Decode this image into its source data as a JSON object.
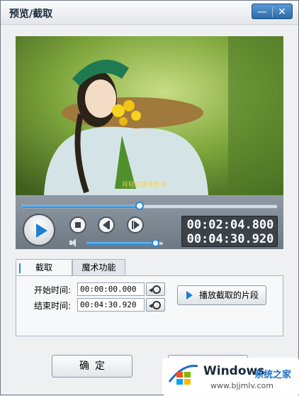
{
  "window": {
    "title": "预览/截取",
    "minimize_label": "—",
    "close_label": "✕"
  },
  "video": {
    "overlay_text": "月轻红雾亭影视"
  },
  "player": {
    "progress_fraction": 0.46,
    "volume_fraction": 0.9,
    "current_time": "00:02:04.800",
    "total_time": "00:04:30.920"
  },
  "tabs": [
    {
      "label": "截取",
      "active": true
    },
    {
      "label": "魔术功能",
      "active": false
    }
  ],
  "clip": {
    "start_label": "开始时间:",
    "start_value": "00:00:00.000",
    "end_label": "结束时间:",
    "end_value": "00:04:30.920",
    "play_clip_label": "播放截取的片段"
  },
  "footer": {
    "ok_label": "确定"
  },
  "watermark": {
    "brand": "Windows",
    "brand_cn": "系统之家",
    "url": "www.bjjmlv.com"
  },
  "colors": {
    "accent": "#2a88d8",
    "title_buttons": "#2b6aa9"
  }
}
